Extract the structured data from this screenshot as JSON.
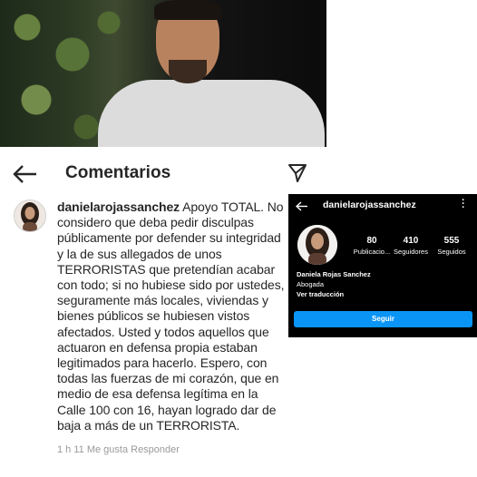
{
  "header": {
    "title": "Comentarios"
  },
  "comment": {
    "username": "danielarojassanchez",
    "text": "Apoyo TOTAL. No considero que deba pedir disculpas públicamente por defender su integridad y la de sus allegados de unos TERRORISTAS que pretendían acabar con todo; si no hubiese sido por ustedes, seguramente más locales, viviendas y bienes públicos se hubiesen vistos afectados. Usted y todos aquellos que actuaron en defensa propia estaban legitimados para hacerlo. Espero, con todas las fuerzas de mi corazón, que en medio de esa defensa legítima en la Calle 100 con 16, hayan logrado dar de baja a más de un TERRORISTA.",
    "meta": "1 h   11 Me gusta   Responder"
  },
  "profile": {
    "username": "danielarojassanchez",
    "stats": [
      {
        "value": "80",
        "label": "Publicacio..."
      },
      {
        "value": "410",
        "label": "Seguidores"
      },
      {
        "value": "555",
        "label": "Seguidos"
      }
    ],
    "name": "Daniela Rojas Sanchez",
    "bio": "Abogada",
    "translate": "Ver traducción",
    "follow_label": "Seguir"
  }
}
